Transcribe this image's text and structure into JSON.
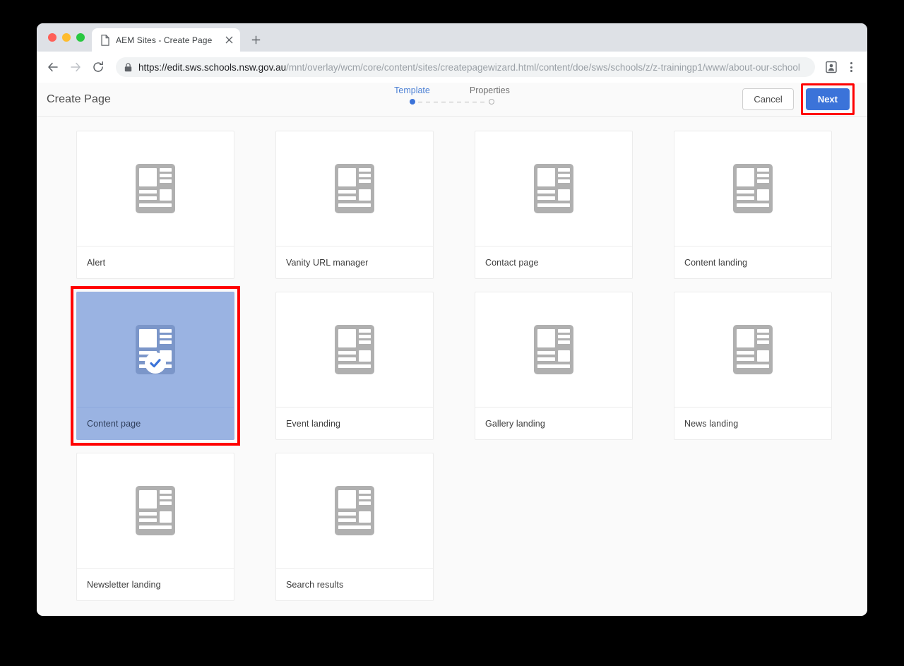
{
  "browser": {
    "tab": {
      "title": "AEM Sites - Create Page",
      "favicon_icon": "page-icon",
      "close_icon": "close-icon"
    },
    "new_tab_icon": "plus-icon",
    "nav": {
      "back_icon": "back-arrow-icon",
      "forward_icon": "forward-arrow-icon",
      "reload_icon": "reload-icon"
    },
    "omnibox": {
      "lock_icon": "lock-icon",
      "url_host": "https://edit.sws.schools.nsw.gov.au",
      "url_path": "/mnt/overlay/wcm/core/content/sites/createpagewizard.html/content/doe/sws/schools/z/z-trainingp1/www/about-our-school",
      "url_full": "https://edit.sws.schools.nsw.gov.au/mnt/overlay/wcm/core/content/sites/createpagewizard.html/content/doe/sws/schools/z/z-trainingp1/www/about-our-school"
    },
    "profile_icon": "contact-card-icon",
    "menu_icon": "three-dot-menu-icon"
  },
  "app": {
    "title": "Create Page",
    "steps": [
      {
        "label": "Template",
        "active": true
      },
      {
        "label": "Properties",
        "active": false
      }
    ],
    "actions": {
      "cancel_label": "Cancel",
      "next_label": "Next"
    }
  },
  "colors": {
    "accent_blue": "#3b73d9",
    "step_active": "#4a7fd4",
    "selected_card_bg": "#9ab3e2",
    "annotation_red": "#ff0000",
    "icon_gray": "#b0b0b0",
    "icon_gray_selected": "#7b96c9"
  },
  "templates": [
    {
      "label": "Alert",
      "selected": false,
      "icon": "page-template-icon"
    },
    {
      "label": "Vanity URL manager",
      "selected": false,
      "icon": "page-template-icon"
    },
    {
      "label": "Contact page",
      "selected": false,
      "icon": "page-template-icon"
    },
    {
      "label": "Content landing",
      "selected": false,
      "icon": "page-template-icon"
    },
    {
      "label": "Content page",
      "selected": true,
      "icon": "page-template-icon",
      "badge_icon": "check-circle-icon"
    },
    {
      "label": "Event landing",
      "selected": false,
      "icon": "page-template-icon"
    },
    {
      "label": "Gallery landing",
      "selected": false,
      "icon": "page-template-icon"
    },
    {
      "label": "News landing",
      "selected": false,
      "icon": "page-template-icon"
    },
    {
      "label": "Newsletter landing",
      "selected": false,
      "icon": "page-template-icon"
    },
    {
      "label": "Search results",
      "selected": false,
      "icon": "page-template-icon"
    }
  ]
}
